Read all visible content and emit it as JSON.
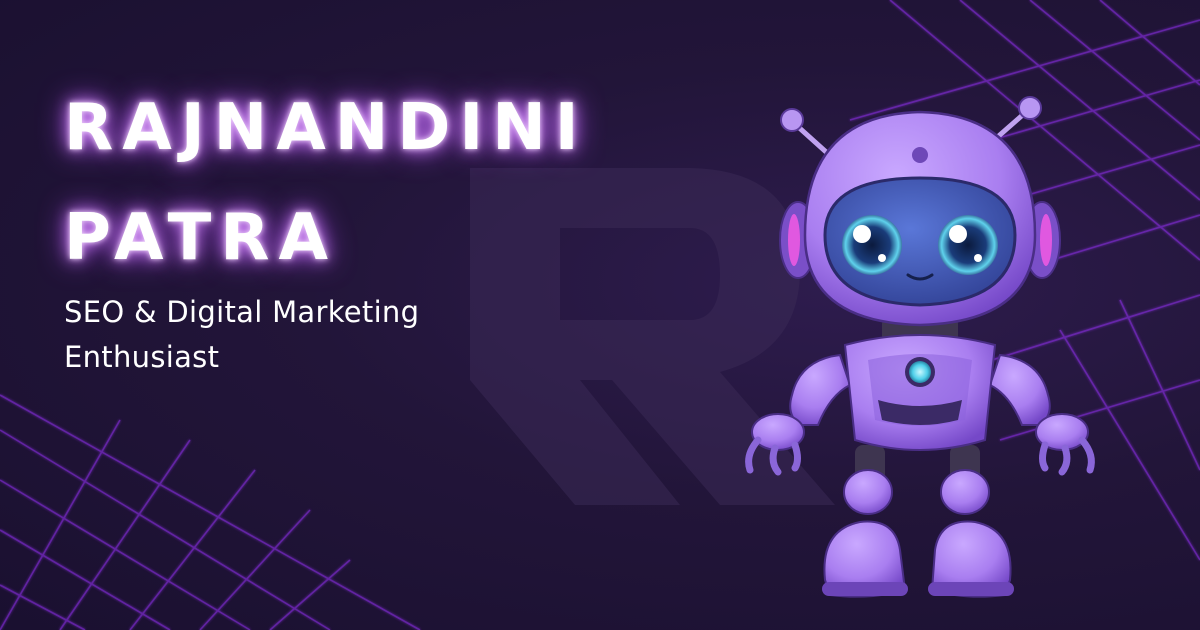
{
  "banner": {
    "name_line1": "RAJNANDINI",
    "name_line2": "PATRA",
    "tagline_line1": "SEO & Digital Marketing",
    "tagline_line2": "Enthusiast"
  },
  "illustration": {
    "subject": "robot-mascot-icon",
    "logo_letter": "R",
    "body_color": "#a97ef0",
    "body_shadow_color": "#7548c8",
    "visor_color": "#3f58b8",
    "eye_color": "#5fd2ec",
    "accent_pink": "#e058e0"
  },
  "colors": {
    "background": "#1a1130",
    "grid_line": "#9b32ff",
    "title_glow": "#d88cff",
    "text": "#ffffff"
  }
}
